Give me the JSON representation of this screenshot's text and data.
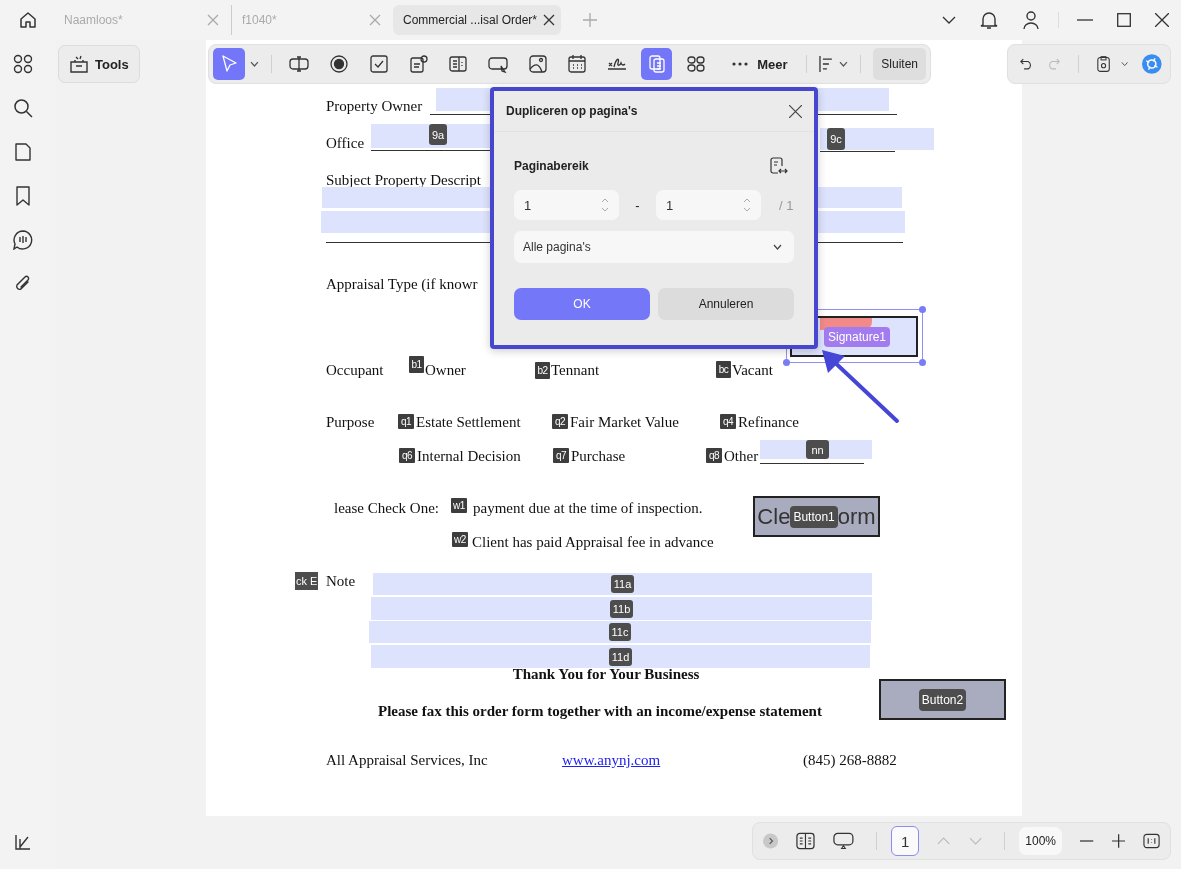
{
  "tabs": [
    {
      "label": "Naamloos*",
      "selected": false
    },
    {
      "label": "f1040*",
      "selected": false
    },
    {
      "label": "Commercial ...isal Order*",
      "selected": true
    }
  ],
  "tools_button": "Tools",
  "toolbar": {
    "items": [
      {
        "kind": "select",
        "selected": true
      },
      {
        "kind": "text-field",
        "selected": false
      },
      {
        "kind": "radio",
        "selected": false
      },
      {
        "kind": "checkbox",
        "selected": false
      },
      {
        "kind": "combo",
        "selected": false
      },
      {
        "kind": "list",
        "selected": false
      },
      {
        "kind": "button",
        "selected": false
      },
      {
        "kind": "image",
        "selected": false
      },
      {
        "kind": "date",
        "selected": false
      },
      {
        "kind": "signature",
        "selected": false
      },
      {
        "kind": "duplicate",
        "selected": true
      },
      {
        "kind": "grid",
        "selected": false
      }
    ],
    "more": "Meer",
    "close": "Sluiten"
  },
  "document": {
    "property_owner": "Property Owner",
    "office": {
      "label": "Office",
      "tags": [
        "9a",
        "9c"
      ]
    },
    "subject": "Subject Property Descript",
    "appraisal_type": "Appraisal Type (if knowr",
    "signature": {
      "tag": "Signature1",
      "selected": true
    },
    "occupant": {
      "label": "Occupant",
      "options": [
        {
          "tag": "b1",
          "label": "Owner"
        },
        {
          "tag": "b2",
          "label": "Tennant"
        },
        {
          "tag": "bc",
          "label": "Vacant"
        }
      ]
    },
    "purpose": {
      "label": "Purpose",
      "options": [
        {
          "tag": "q1",
          "label": "Estate Settlement"
        },
        {
          "tag": "q2",
          "label": "Fair Market Value"
        },
        {
          "tag": "q4",
          "label": "Refinance"
        },
        {
          "tag": "q6",
          "label": "Internal Decision"
        },
        {
          "tag": "q7",
          "label": "Purchase"
        },
        {
          "tag": "q8",
          "label": "Other"
        }
      ],
      "other_tag": "nn"
    },
    "check_one": {
      "label": "lease Check One:",
      "options": [
        {
          "tag": "w1",
          "label": "payment due at the time of inspection."
        },
        {
          "tag": "w2",
          "label": "Client has paid Appraisal fee in advance"
        }
      ]
    },
    "button1": {
      "label_parts": [
        "Cle",
        "orm"
      ],
      "tag": "Button1"
    },
    "side_tag": "ck E",
    "note": {
      "label": "Note",
      "fields": [
        "11a",
        "11b",
        "11c",
        "11d"
      ]
    },
    "thanks": "Thank You for Your Business",
    "fax_note": "Please fax this order form together with an income/expense statement",
    "button2": {
      "tag": "Button2"
    },
    "footer": {
      "company": "All Appraisal Services, Inc",
      "link": "www.anynj.com",
      "phone": "(845) 268-8882"
    }
  },
  "dialog": {
    "title": "Dupliceren op pagina's",
    "section": "Paginabereik",
    "from": "1",
    "separator": "-",
    "to": "1",
    "total": "/ 1",
    "range": "Alle pagina's",
    "buttons": [
      {
        "label": "OK",
        "kind": "primary"
      },
      {
        "label": "Annuleren",
        "kind": "secondary"
      }
    ]
  },
  "bottom_bar": {
    "page": "1",
    "zoom": "100%"
  }
}
